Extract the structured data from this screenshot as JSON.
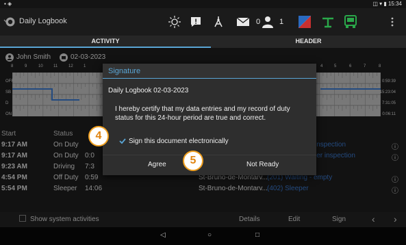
{
  "status_bar": {
    "time": "15:34",
    "left_icons": "▪ ◈",
    "right_icons": "◫ ▾ ▮"
  },
  "app_bar": {
    "title": "Daily Logbook",
    "messages_count": "0",
    "users_count": "1",
    "icons": [
      "back-icon",
      "logbook-icon",
      "sun-icon",
      "alert-icon",
      "inspection-icon",
      "mail-icon",
      "user-icon",
      "flag-icon",
      "trailer-icon",
      "truck-icon",
      "more-icon"
    ]
  },
  "tabs": [
    {
      "label": "ACTIVITY",
      "active": true
    },
    {
      "label": "HEADER",
      "active": false
    }
  ],
  "driver": {
    "name": "John Smith",
    "date": "02-03-2023"
  },
  "grid": {
    "rows": [
      "OFF",
      "SB",
      "D",
      "ON"
    ],
    "hour_labels": [
      "8",
      "9",
      "10",
      "11",
      "12",
      "1",
      "4",
      "5",
      "6",
      "7",
      "8"
    ],
    "totals": [
      "0:59:39",
      "15:23:04",
      "7:31:05",
      "0:06:11"
    ]
  },
  "table": {
    "headers": {
      "start": "Start",
      "status": "Status"
    },
    "rows": [
      {
        "start": "9:17 AM",
        "status": "On Duty",
        "duration": "",
        "location": "",
        "note": "inspection"
      },
      {
        "start": "9:17 AM",
        "status": "On Duty",
        "duration": "0:0",
        "location": "",
        "note": "ler inspection"
      },
      {
        "start": "9:23 AM",
        "status": "Driving",
        "duration": "7:3",
        "location": "",
        "note": ""
      },
      {
        "start": "4:54 PM",
        "status": "Off Duty",
        "duration": "0:59",
        "location": "St-Bruno-de-Montarv...",
        "note": "(201) Waiting - empty"
      },
      {
        "start": "5:54 PM",
        "status": "Sleeper",
        "duration": "14:06",
        "location": "St-Bruno-de-Montarv...",
        "note": "(402) Sleeper"
      }
    ]
  },
  "bottom_bar": {
    "show_system": "Show system activities",
    "details": "Details",
    "edit": "Edit",
    "sign": "Sign",
    "prev": "‹",
    "next": "›"
  },
  "dialog": {
    "title": "Signature",
    "subtitle": "Daily Logbook 02-03-2023",
    "body": "I hereby certify that my data entries and my record of duty status for this 24-hour period are true and correct.",
    "checkbox_label": "Sign this document electronically",
    "checked": true,
    "agree": "Agree",
    "not_ready": "Not Ready"
  },
  "callouts": [
    "4",
    "5"
  ],
  "colors": {
    "accent": "#5aa6d6",
    "callout": "#f0a020",
    "link": "#3b7bd4"
  }
}
